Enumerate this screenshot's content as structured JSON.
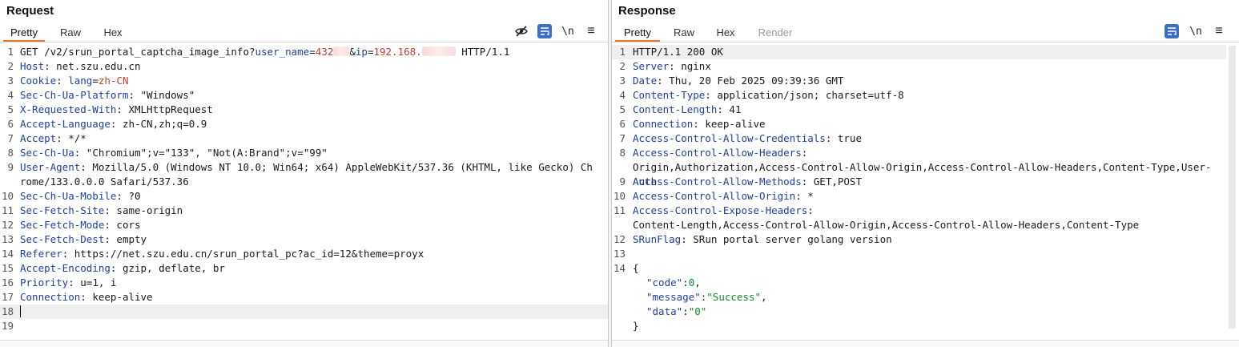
{
  "request": {
    "title": "Request",
    "tabs": [
      {
        "label": "Pretty",
        "active": true
      },
      {
        "label": "Raw"
      },
      {
        "label": "Hex"
      }
    ],
    "tools": {
      "newline": "\\n",
      "menu": "≡"
    },
    "request_line": {
      "start": "GET /v2/srun_portal_captcha_image_info?",
      "p1_key": "user_name",
      "eq": "=",
      "p1_val": "432",
      "amp": "&",
      "p2_key": "ip",
      "p2_val": "192.168.",
      "end": " HTTP/1.1"
    },
    "headers": [
      {
        "num": "2",
        "name": "Host",
        "value": " net.szu.edu.cn"
      },
      {
        "num": "3",
        "name": "Cookie",
        "value": "",
        "cookie": {
          "key": "lang",
          "val": "zh-CN"
        }
      },
      {
        "num": "4",
        "name": "Sec-Ch-Ua-Platform",
        "value": " \"Windows\""
      },
      {
        "num": "5",
        "name": "X-Requested-With",
        "value": " XMLHttpRequest"
      },
      {
        "num": "6",
        "name": "Accept-Language",
        "value": " zh-CN,zh;q=0.9"
      },
      {
        "num": "7",
        "name": "Accept",
        "value": " */*"
      },
      {
        "num": "8",
        "name": "Sec-Ch-Ua",
        "value": " \"Chromium\";v=\"133\", \"Not(A:Brand\";v=\"99\""
      },
      {
        "num": "9",
        "name": "User-Agent",
        "value": " Mozilla/5.0 (Windows NT 10.0; Win64; x64) AppleWebKit/537.36 (KHTML, like Gecko) Chrome/133.0.0.0 Safari/537.36"
      },
      {
        "num": "10",
        "name": "Sec-Ch-Ua-Mobile",
        "value": " ?0"
      },
      {
        "num": "11",
        "name": "Sec-Fetch-Site",
        "value": " same-origin"
      },
      {
        "num": "12",
        "name": "Sec-Fetch-Mode",
        "value": " cors"
      },
      {
        "num": "13",
        "name": "Sec-Fetch-Dest",
        "value": " empty"
      },
      {
        "num": "14",
        "name": "Referer",
        "value": " https://net.szu.edu.cn/srun_portal_pc?ac_id=12&theme=proyx"
      },
      {
        "num": "15",
        "name": "Accept-Encoding",
        "value": " gzip, deflate, br"
      },
      {
        "num": "16",
        "name": "Priority",
        "value": " u=1, i"
      },
      {
        "num": "17",
        "name": "Connection",
        "value": " keep-alive"
      }
    ],
    "empty_lines": [
      "18",
      "19"
    ]
  },
  "response": {
    "title": "Response",
    "tabs": [
      {
        "label": "Pretty",
        "active": true
      },
      {
        "label": "Raw"
      },
      {
        "label": "Hex"
      },
      {
        "label": "Render",
        "disabled": true
      }
    ],
    "tools": {
      "newline": "\\n",
      "menu": "≡"
    },
    "status_line": "HTTP/1.1 200 OK",
    "headers": [
      {
        "num": "2",
        "name": "Server",
        "value": " nginx"
      },
      {
        "num": "3",
        "name": "Date",
        "value": " Thu, 20 Feb 2025 09:39:36 GMT"
      },
      {
        "num": "4",
        "name": "Content-Type",
        "value": " application/json; charset=utf-8"
      },
      {
        "num": "5",
        "name": "Content-Length",
        "value": " 41"
      },
      {
        "num": "6",
        "name": "Connection",
        "value": " keep-alive"
      },
      {
        "num": "7",
        "name": "Access-Control-Allow-Credentials",
        "value": " true"
      },
      {
        "num": "8",
        "name": "Access-Control-Allow-Headers",
        "value": "\nOrigin,Authorization,Access-Control-Allow-Origin,Access-Control-Allow-Headers,Content-Type,User-Auth"
      },
      {
        "num": "9",
        "name": "Access-Control-Allow-Methods",
        "value": " GET,POST"
      },
      {
        "num": "10",
        "name": "Access-Control-Allow-Origin",
        "value": " *"
      },
      {
        "num": "11",
        "name": "Access-Control-Expose-Headers",
        "value": "\nContent-Length,Access-Control-Allow-Origin,Access-Control-Allow-Headers,Content-Type"
      },
      {
        "num": "12",
        "name": "SRunFlag",
        "value": " SRun portal server golang version"
      }
    ],
    "blank_num": "13",
    "body_num": "14",
    "body": {
      "open": "{",
      "fields": [
        {
          "key": "\"code\"",
          "colon": ":",
          "val": "0",
          "comma": ","
        },
        {
          "key": "\"message\"",
          "colon": ":",
          "val": "\"Success\"",
          "comma": ","
        },
        {
          "key": "\"data\"",
          "colon": ":",
          "val": "\"0\"",
          "comma": ""
        }
      ],
      "close": "}"
    }
  },
  "colors": {
    "accent": "#e8742a",
    "header_key": "#1f3f9e",
    "param_value": "#c23d2a",
    "json_value": "#0f8a2a",
    "tool_active": "#3c6fc0"
  }
}
